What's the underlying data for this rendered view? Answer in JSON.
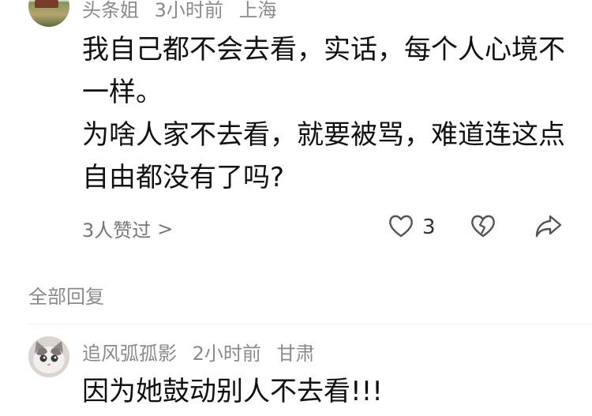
{
  "comment": {
    "author": "头条姐",
    "time": "3小时前",
    "location": "上海",
    "paragraphs": [
      "我自己都不会去看，实话，每个人心境不一样。",
      "为啥人家不去看，就要被骂，难道连这点自由都没有了吗?"
    ],
    "likers_text": "3人赞过",
    "likers_chevron": ">",
    "like_count": "3",
    "icons": {
      "like": "heart-outline-icon",
      "dislike": "broken-heart-icon",
      "share": "share-arrow-icon"
    }
  },
  "replies_section": {
    "label": "全部回复"
  },
  "reply": {
    "author": "追风弧孤影",
    "time": "2小时前",
    "location": "甘肃",
    "text": "因为她鼓动别人不去看!!!"
  },
  "colors": {
    "text_primary": "#111111",
    "text_secondary": "#8a8a8a",
    "icon": "#555555"
  }
}
